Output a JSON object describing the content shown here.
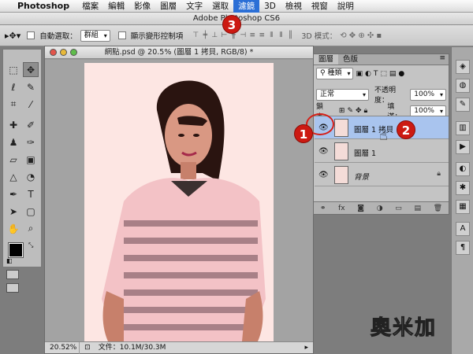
{
  "menubar": {
    "apple": "",
    "app_name": "Photoshop",
    "items": [
      "檔案",
      "編輯",
      "影像",
      "圖層",
      "文字",
      "選取",
      "濾鏡",
      "3D",
      "檢視",
      "視窗",
      "說明"
    ],
    "active_index": 6
  },
  "app_title": "Adobe Photoshop CS6",
  "options_bar": {
    "auto_select_label": "自動選取：",
    "auto_select_value": "群組",
    "transform_controls_label": "顯示變形控制項",
    "mode_3d_label": "3D 模式："
  },
  "document": {
    "title": "網點.psd @ 20.5% (圖層 1 拷貝, RGB/8) *",
    "zoom": "20.52%",
    "file_info": "文件：10.1M/30.3M"
  },
  "layers_panel": {
    "tabs": [
      "圖層",
      "色版"
    ],
    "kind_label": "種類",
    "blend_mode": "正常",
    "opacity_label": "不透明度：",
    "opacity_value": "100%",
    "lock_label": "鎖定：",
    "fill_label": "填滿：",
    "fill_value": "100%",
    "layers": [
      {
        "name": "圖層 1 拷貝",
        "selected": true
      },
      {
        "name": "圖層 1",
        "selected": false
      },
      {
        "name": "背景",
        "selected": false,
        "locked": true
      }
    ],
    "footer_fx": "fx"
  },
  "annotations": [
    "1",
    "2",
    "3"
  ],
  "watermark": "奧米加",
  "colors": {
    "menu_active": "#2b6fd6",
    "layer_selected": "#a9c4ee",
    "badge": "#cc1a12"
  }
}
